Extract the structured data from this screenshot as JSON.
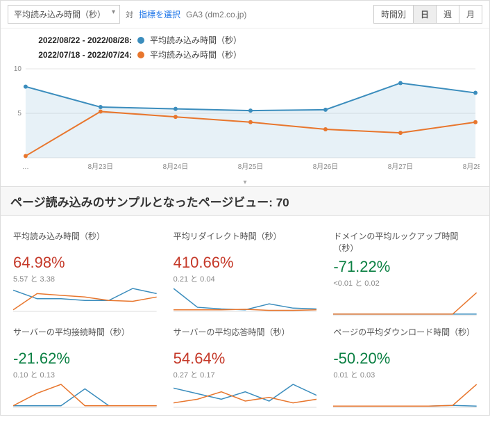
{
  "toolbar": {
    "metric_label": "平均読み込み時間（秒）",
    "vs_label": "対",
    "select_metric_link": "指標を選択",
    "source_label": "GA3 (dm2.co.jp)",
    "granularity": {
      "hour": "時間別",
      "day": "日",
      "week": "週",
      "month": "月"
    }
  },
  "legend": {
    "range_current": "2022/08/22 - 2022/08/28:",
    "range_prev": "2022/07/18 - 2022/07/24:",
    "series_label": "平均読み込み時間（秒）"
  },
  "headline": {
    "prefix": "ページ読み込みのサンプルとなったページビュー: ",
    "value": "70"
  },
  "cards": [
    {
      "title": "平均読み込み時間（秒）",
      "pct": "64.98%",
      "dir": "up",
      "sub": "5.57 と 3.38"
    },
    {
      "title": "平均リダイレクト時間（秒）",
      "pct": "410.66%",
      "dir": "up",
      "sub": "0.21 と 0.04"
    },
    {
      "title": "ドメインの平均ルックアップ時間（秒）",
      "pct": "-71.22%",
      "dir": "down",
      "sub": "<0.01 と 0.02"
    },
    {
      "title": "サーバーの平均接続時間（秒）",
      "pct": "-21.62%",
      "dir": "down",
      "sub": "0.10 と 0.13"
    },
    {
      "title": "サーバーの平均応答時間（秒）",
      "pct": "54.64%",
      "dir": "up",
      "sub": "0.27 と 0.17"
    },
    {
      "title": "ページの平均ダウンロード時間（秒）",
      "pct": "-50.20%",
      "dir": "down",
      "sub": "0.01 と 0.03"
    }
  ],
  "chart_data": {
    "type": "line",
    "title": "平均読み込み時間（秒）",
    "xlabel": "",
    "ylabel": "",
    "ylim": [
      0,
      10
    ],
    "categories": [
      "…",
      "8月23日",
      "8月24日",
      "8月25日",
      "8月26日",
      "8月27日",
      "8月28日"
    ],
    "series": [
      {
        "name": "2022/08/22 - 2022/08/28 平均読み込み時間（秒）",
        "color": "#3b8dbd",
        "values": [
          8.0,
          5.7,
          5.5,
          5.3,
          5.4,
          8.4,
          7.3
        ]
      },
      {
        "name": "2022/07/18 - 2022/07/24 平均読み込み時間（秒）",
        "color": "#e8762d",
        "values": [
          0.2,
          5.2,
          4.6,
          4.0,
          3.2,
          2.8,
          4.0
        ]
      }
    ],
    "sparklines": [
      {
        "blue": [
          1.2,
          0.7,
          0.7,
          0.6,
          0.6,
          1.3,
          1.0
        ],
        "orange": [
          0.05,
          1.0,
          0.9,
          0.8,
          0.6,
          0.55,
          0.8
        ]
      },
      {
        "blue": [
          1.3,
          0.2,
          0.1,
          0.05,
          0.4,
          0.15,
          0.1
        ],
        "orange": [
          0.05,
          0.05,
          0.05,
          0.08,
          0.02,
          0.02,
          0.05
        ]
      },
      {
        "blue": [
          0.02,
          0.02,
          0.02,
          0.02,
          0.02,
          0.02,
          0.02
        ],
        "orange": [
          0.02,
          0.02,
          0.02,
          0.02,
          0.02,
          0.02,
          0.6
        ]
      },
      {
        "blue": [
          0.02,
          0.02,
          0.02,
          0.4,
          0.02,
          0.02,
          0.02
        ],
        "orange": [
          0.02,
          0.3,
          0.5,
          0.02,
          0.02,
          0.02,
          0.02
        ]
      },
      {
        "blue": [
          0.5,
          0.35,
          0.2,
          0.4,
          0.15,
          0.6,
          0.3
        ],
        "orange": [
          0.1,
          0.2,
          0.4,
          0.15,
          0.25,
          0.1,
          0.2
        ]
      },
      {
        "blue": [
          0.02,
          0.02,
          0.02,
          0.02,
          0.02,
          0.05,
          0.02
        ],
        "orange": [
          0.02,
          0.02,
          0.02,
          0.02,
          0.02,
          0.05,
          0.9
        ]
      }
    ]
  }
}
